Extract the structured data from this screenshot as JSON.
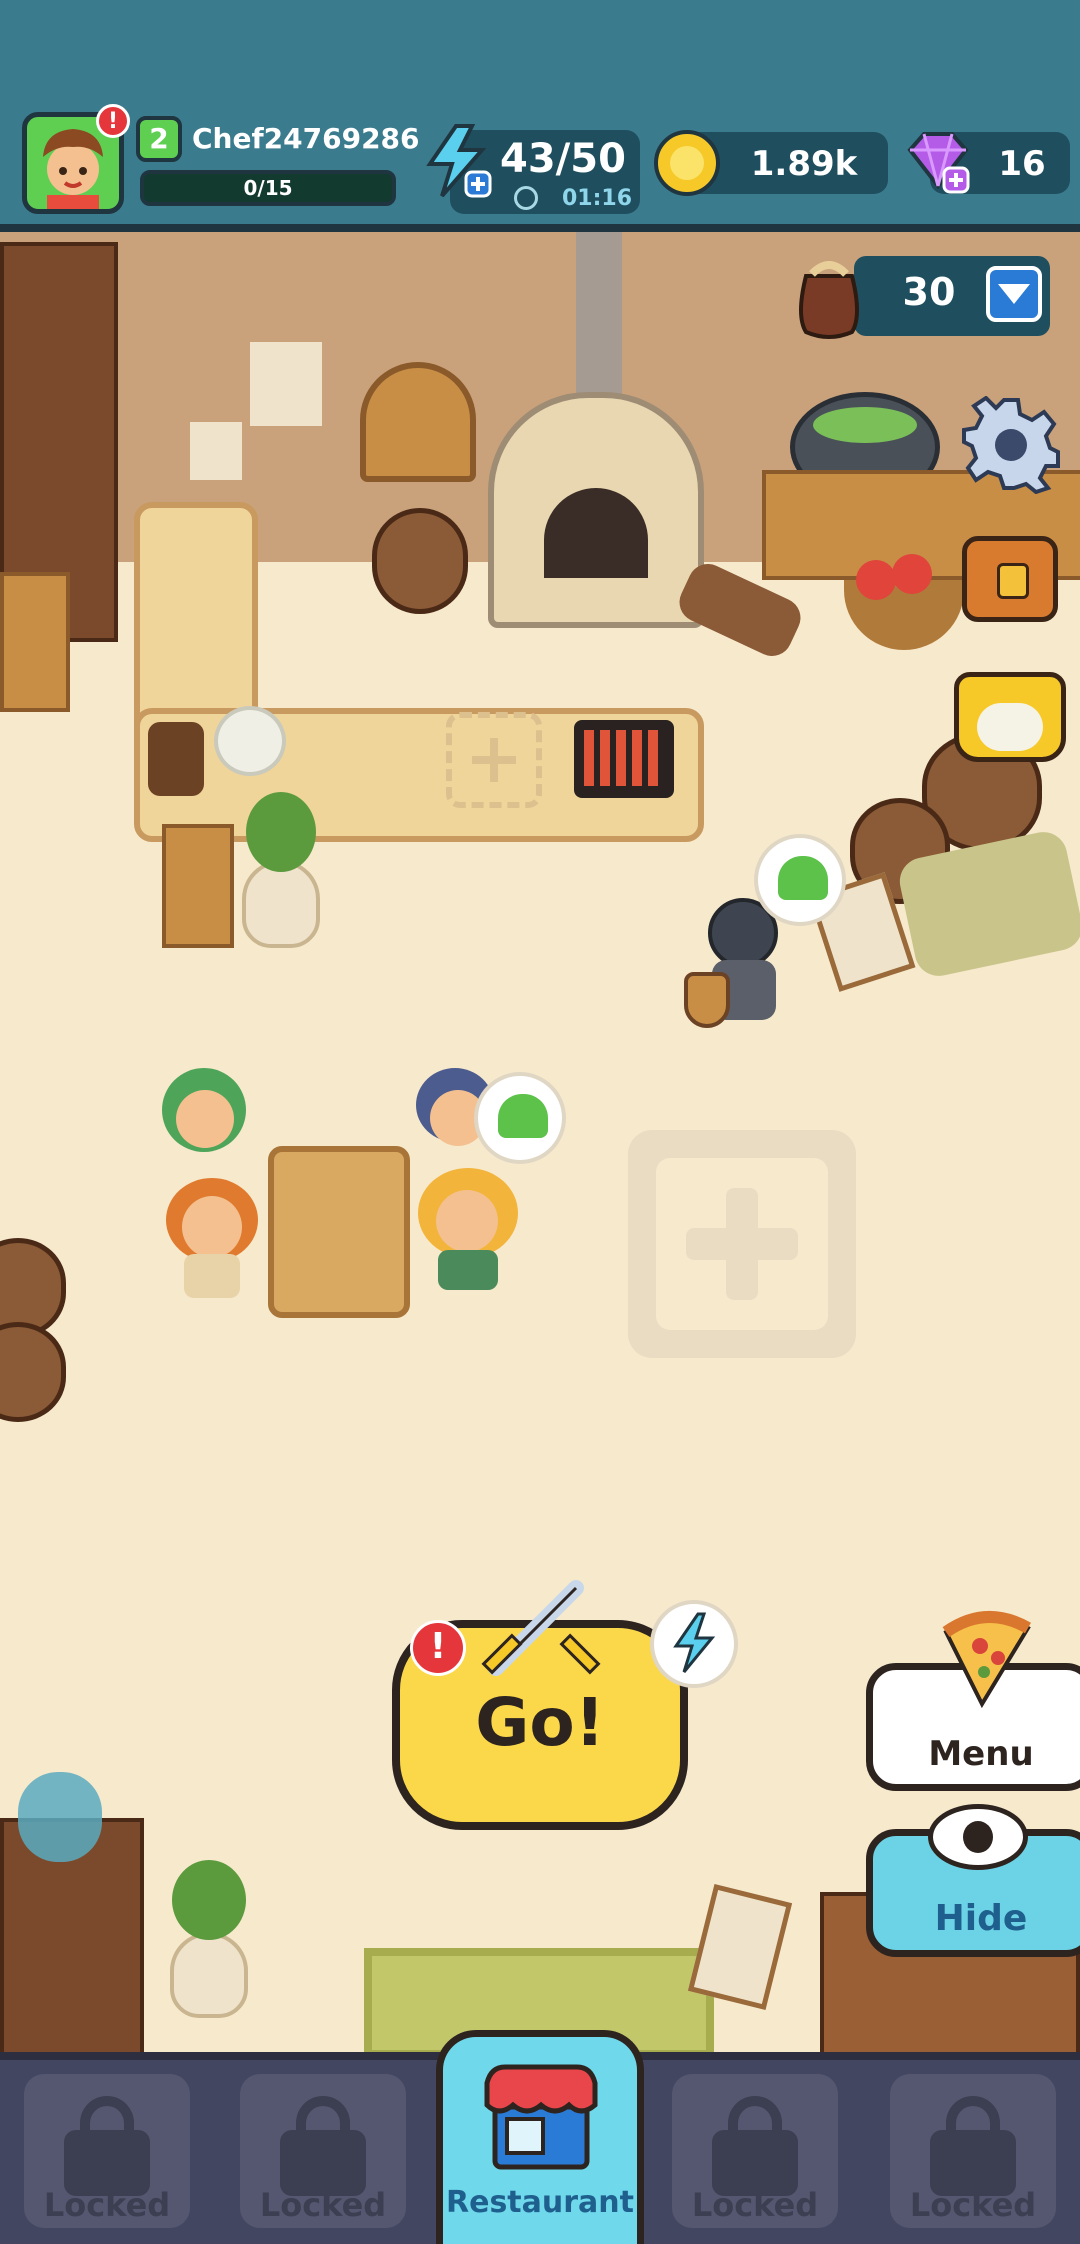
{
  "player": {
    "level": "2",
    "name": "Chef24769286",
    "xp_progress_text": "0/15",
    "xp_progress_fraction": 0,
    "alert_mark": "!"
  },
  "energy": {
    "value": "43/50",
    "timer": "01:16",
    "icon": "lightning-icon"
  },
  "coins": {
    "value": "1.89k",
    "icon": "coin-icon"
  },
  "gems": {
    "value": "16",
    "icon": "gem-icon"
  },
  "bag": {
    "count": "30",
    "icon": "bag-icon"
  },
  "side_icons": [
    "gear-icon",
    "chest-icon",
    "crown-icon"
  ],
  "actions": {
    "go_label": "Go!",
    "menu_label": "Menu",
    "hide_label": "Hide"
  },
  "nav": {
    "tabs": [
      {
        "label": "Locked",
        "state": "locked"
      },
      {
        "label": "Locked",
        "state": "locked"
      },
      {
        "label": "Restaurant",
        "state": "active"
      },
      {
        "label": "Locked",
        "state": "locked"
      },
      {
        "label": "Locked",
        "state": "locked"
      }
    ]
  },
  "colors": {
    "hud": "#3b7b8e",
    "go_button": "#fbd74a",
    "hide_button": "#6cd3e6",
    "nav_active": "#6fd8ea",
    "alert": "#e5363b"
  }
}
